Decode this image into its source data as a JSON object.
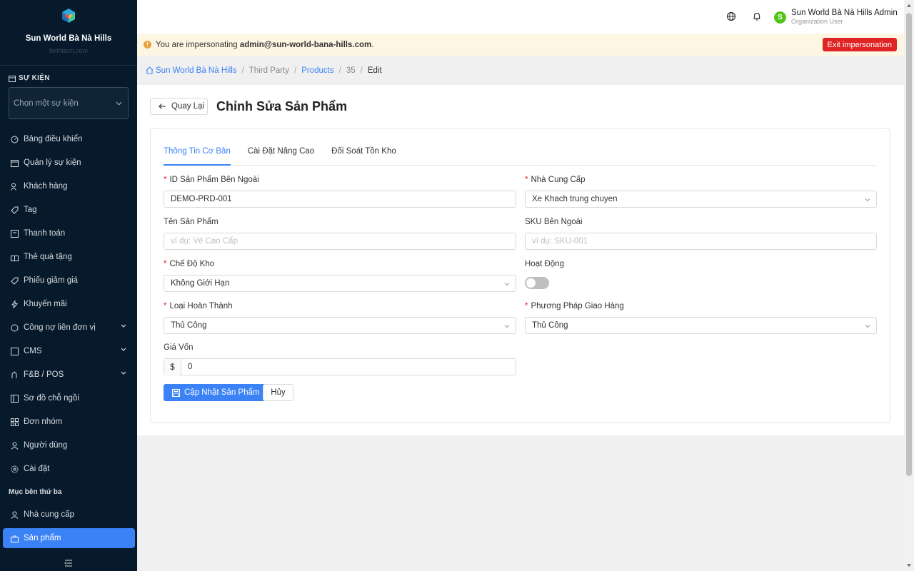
{
  "sidebar": {
    "brand_name": "Sun World Bà Nà Hills",
    "brand_sub": "birthtech.com",
    "event_section_title": "SỰ KIỆN",
    "event_select_placeholder": "Chọn một sự kiện",
    "items": [
      {
        "label": "Bảng điều khiển",
        "icon": "dashboard-icon"
      },
      {
        "label": "Quản lý sự kiện",
        "icon": "calendar-icon"
      },
      {
        "label": "Khách hàng",
        "icon": "users-icon"
      },
      {
        "label": "Tag",
        "icon": "tag-icon"
      },
      {
        "label": "Thanh toán",
        "icon": "payment-icon"
      },
      {
        "label": "Thẻ quà tặng",
        "icon": "gift-icon"
      },
      {
        "label": "Phiếu giảm giá",
        "icon": "coupon-icon"
      },
      {
        "label": "Khuyến mãi",
        "icon": "flash-icon"
      },
      {
        "label": "Công nợ liên đơn vị",
        "icon": "debt-icon"
      },
      {
        "label": "CMS",
        "icon": "cms-icon"
      },
      {
        "label": "F&B / POS",
        "icon": "pos-icon"
      },
      {
        "label": "Sơ đồ chỗ ngồi",
        "icon": "seatmap-icon"
      },
      {
        "label": "Đơn nhóm",
        "icon": "group-order-icon"
      },
      {
        "label": "Người dùng",
        "icon": "user-icon"
      },
      {
        "label": "Cài đặt",
        "icon": "settings-icon"
      }
    ],
    "third_party_label": "Mục bên thứ ba",
    "third_party_items": [
      {
        "label": "Nhà cung cấp",
        "icon": "supplier-icon"
      },
      {
        "label": "Sản phẩm",
        "icon": "product-icon"
      }
    ]
  },
  "topbar": {
    "user_initial": "S",
    "user_name": "Sun World Bà Nà Hills Admin",
    "user_role": "Organization User"
  },
  "banner": {
    "prefix": "You are impersonating ",
    "email": "admin@sun-world-bana-hills.com",
    "suffix": ".",
    "exit_label": "Exit impersonation"
  },
  "breadcrumb": {
    "home": "Sun World Bà Nà Hills",
    "level1": "Third Party",
    "level2": "Products",
    "level3": "35",
    "current": "Edit"
  },
  "page": {
    "back_label": "Quay Lại",
    "title": "Chỉnh Sửa Sản Phẩm"
  },
  "tabs": [
    "Thông Tin Cơ Bản",
    "Cài Đặt Nâng Cao",
    "Đối Soát Tồn Kho"
  ],
  "form": {
    "external_id_label": "ID Sản Phẩm Bên Ngoài",
    "external_id_value": "DEMO-PRD-001",
    "supplier_label": "Nhà Cung Cấp",
    "supplier_value": "Xe Khach trung chuyen",
    "product_name_label": "Tên Sản Phẩm",
    "product_name_placeholder": "ví dụ: Vé Cao Cấp",
    "external_sku_label": "SKU Bên Ngoài",
    "external_sku_placeholder": "ví dụ: SKU-001",
    "inventory_mode_label": "Chế Độ Kho",
    "inventory_mode_value": "Không Giới Hạn",
    "active_label": "Hoạt Động",
    "fulfillment_label": "Loại Hoàn Thành",
    "fulfillment_value": "Thủ Công",
    "delivery_label": "Phương Pháp Giao Hàng",
    "delivery_value": "Thủ Công",
    "cost_label": "Giá Vốn",
    "currency_symbol": "$",
    "cost_value": "0",
    "submit_label": "Cập Nhật Sản Phẩm",
    "cancel_label": "Hủy"
  },
  "colors": {
    "sidebar_bg": "#071a2b",
    "accent": "#3b82f6",
    "danger": "#e02424",
    "banner_bg": "#fdf6e3"
  }
}
